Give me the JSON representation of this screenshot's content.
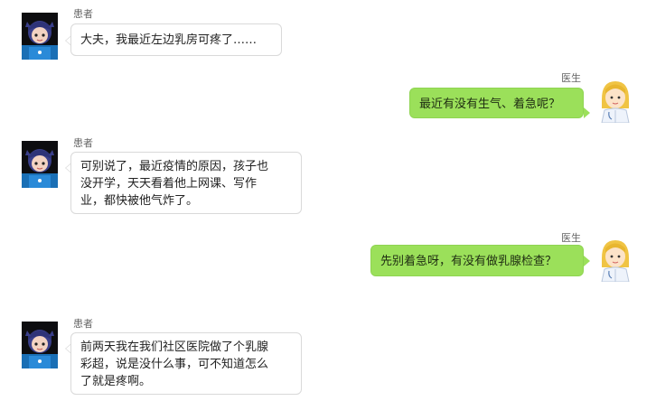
{
  "colors": {
    "doctor_bubble": "#9be05a",
    "patient_bubble": "#ffffff",
    "patient_border": "#d9d9d9"
  },
  "messages": [
    {
      "role": "patient",
      "sender": "患者",
      "avatar_icon": "patient-avatar-icon",
      "text": "大夫，我最近左边乳房可疼了……"
    },
    {
      "role": "doctor",
      "sender": "医生",
      "avatar_icon": "doctor-avatar-icon",
      "text": "最近有没有生气、着急呢？"
    },
    {
      "role": "patient",
      "sender": "患者",
      "avatar_icon": "patient-avatar-icon",
      "text": "可别说了，最近疫情的原因，孩子也\n没开学，天天看着他上网课、写作\n业，都快被他气炸了。"
    },
    {
      "role": "doctor",
      "sender": "医生",
      "avatar_icon": "doctor-avatar-icon",
      "text": "先别着急呀，有没有做乳腺检查？"
    },
    {
      "role": "patient",
      "sender": "患者",
      "avatar_icon": "patient-avatar-icon",
      "text": "前两天我在我们社区医院做了个乳腺\n彩超，说是没什么事，可不知道怎么\n了就是疼啊。"
    }
  ]
}
